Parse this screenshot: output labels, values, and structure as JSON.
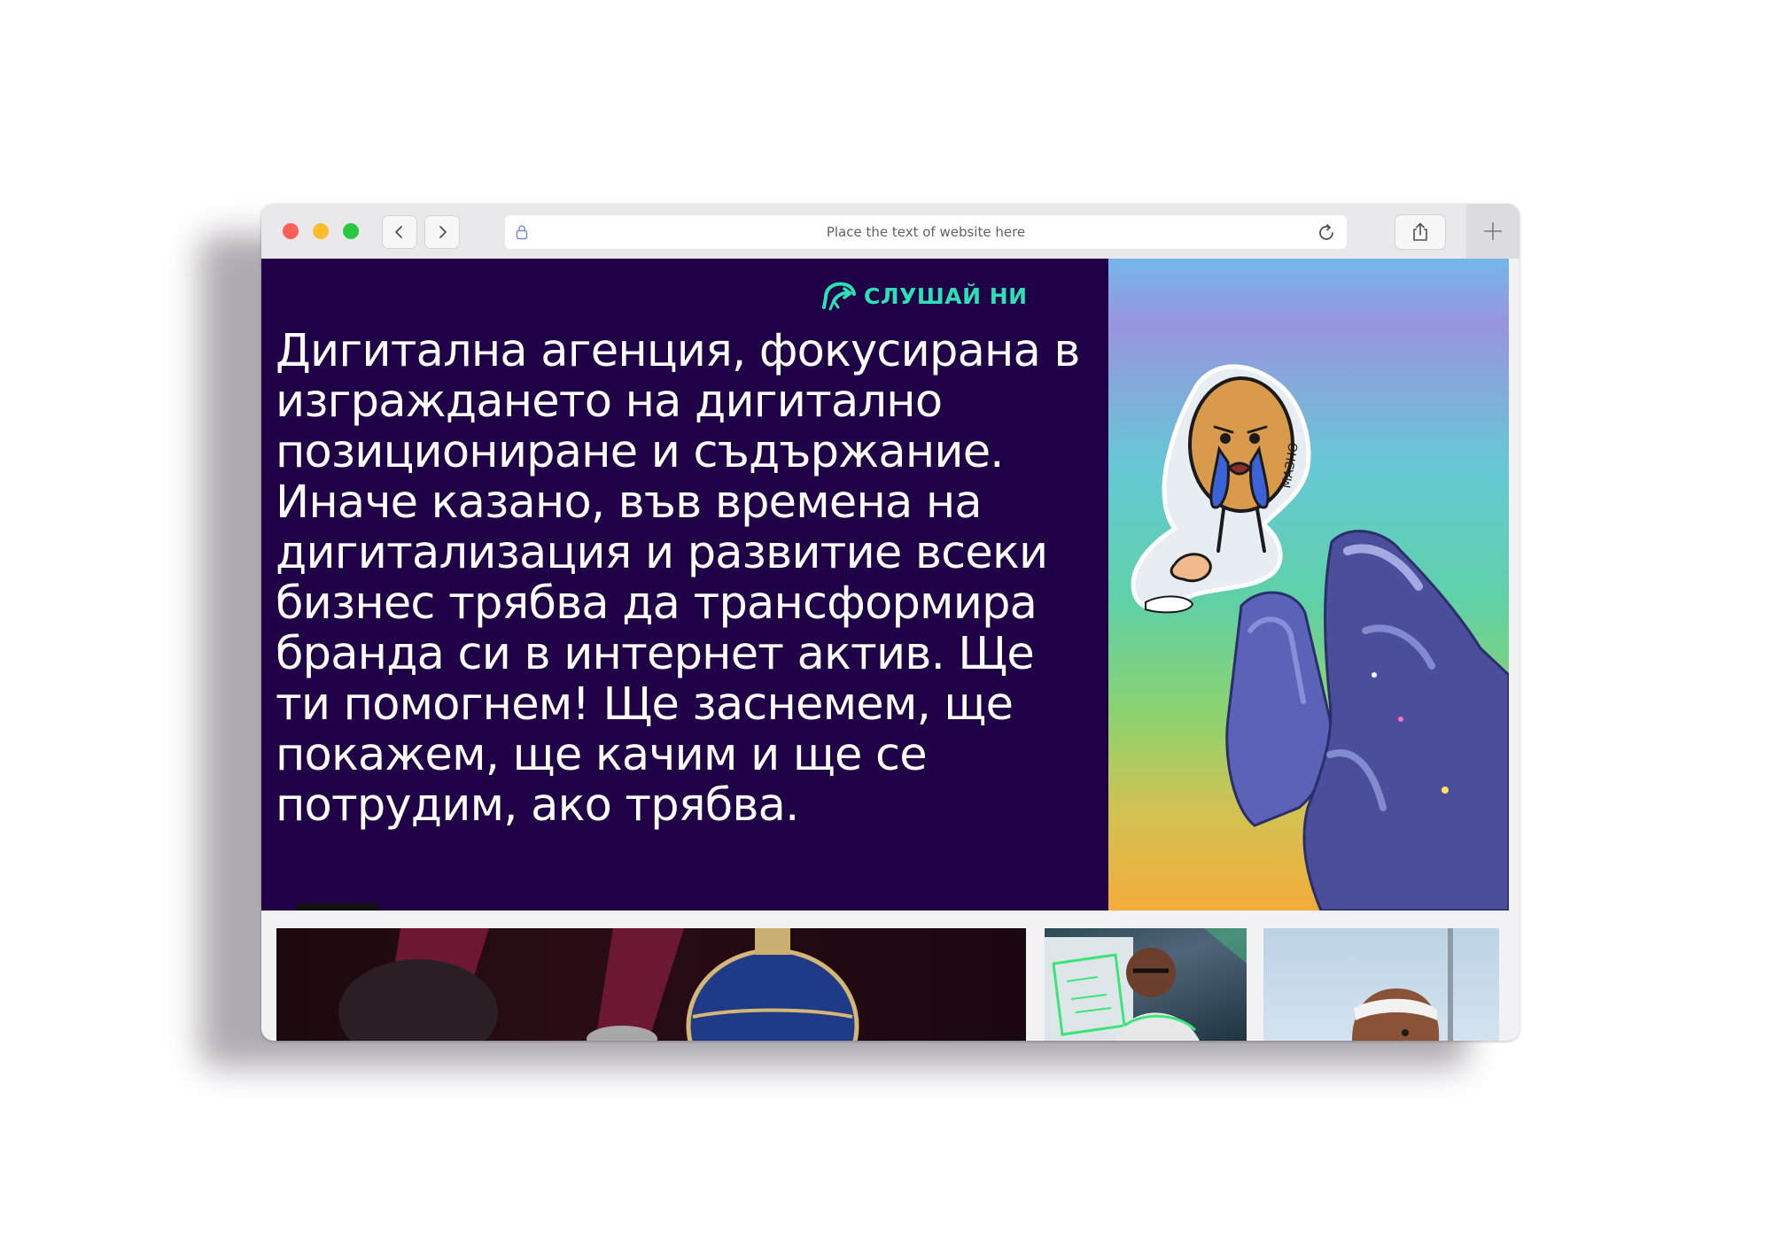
{
  "browser": {
    "address_placeholder": "Place the text of website here",
    "icons": [
      "back-chevron-icon",
      "forward-chevron-icon",
      "lock-icon",
      "reload-icon",
      "share-icon",
      "plus-icon"
    ],
    "colors": {
      "close": "#fe5f57",
      "minimize": "#febc2e",
      "zoom": "#28c840"
    }
  },
  "hero": {
    "listen_label": "СЛУШАЙ НИ",
    "headline": "Дигитална агенция, фокусирана в изграждането на дигитално позициониране и съдържание. Иначе казано, във времена на дигитализация и развитие всеки бизнес трябва да трансформира бранда си в интернет актив. Ще ти помогнем! Ще заснемем, ще покажем, ще качим и ще се потрудим, ако трябва.",
    "background_color": "#200046",
    "accent_color": "#2ce0b4"
  },
  "gallery": {
    "items": [
      "thumbnail-jewelled-egg",
      "thumbnail-artist-with-glasses",
      "thumbnail-man-with-headband"
    ]
  }
}
